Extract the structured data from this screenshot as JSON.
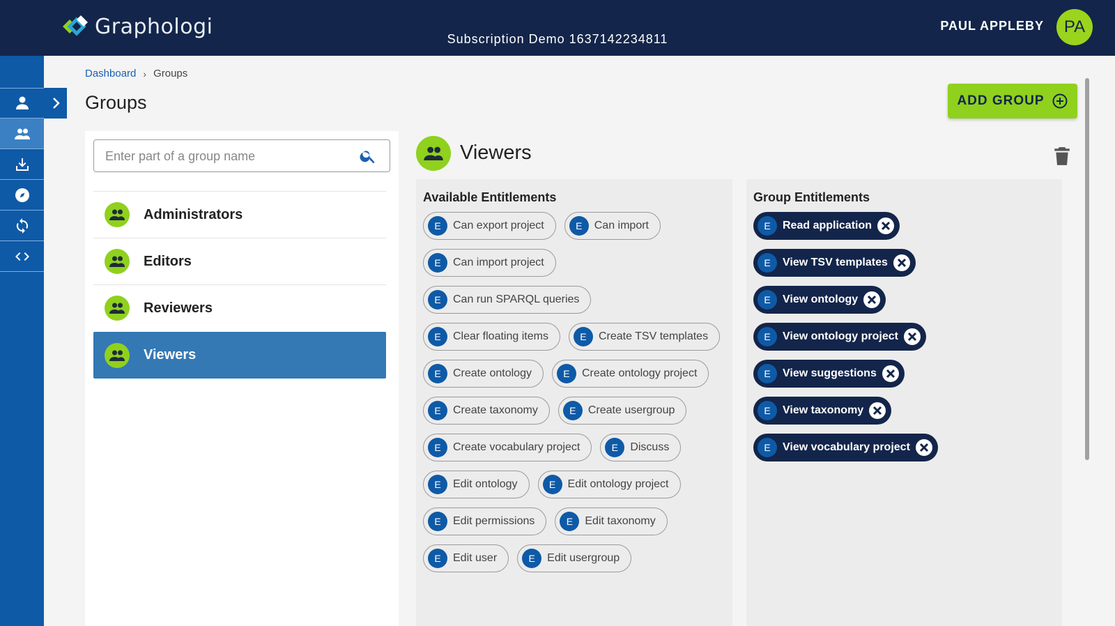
{
  "app": {
    "logo_text": "Graphologi",
    "subscription": "Subscription Demo 1637142234811",
    "user_name": "PAUL APPLEBY",
    "user_initials": "PA"
  },
  "rail": {
    "items": [
      {
        "icon": "person-icon"
      },
      {
        "icon": "people-icon",
        "active": true
      },
      {
        "icon": "download-icon"
      },
      {
        "icon": "compass-icon"
      },
      {
        "icon": "sync-icon"
      },
      {
        "icon": "code-icon"
      }
    ],
    "expand_icon": "chevron-right-icon"
  },
  "breadcrumb": {
    "items": [
      "Dashboard",
      "Groups"
    ],
    "separator": "›"
  },
  "page": {
    "title": "Groups",
    "add_button": "ADD GROUP"
  },
  "search": {
    "placeholder": "Enter part of a group name",
    "value": ""
  },
  "groups": [
    {
      "name": "Administrators",
      "selected": false
    },
    {
      "name": "Editors",
      "selected": false
    },
    {
      "name": "Reviewers",
      "selected": false
    },
    {
      "name": "Viewers",
      "selected": true
    }
  ],
  "detail": {
    "title": "Viewers",
    "available_title": "Available Entitlements",
    "group_title": "Group Entitlements",
    "chip_badge": "E",
    "available": [
      "Can export project",
      "Can import",
      "Can import project",
      "Can run SPARQL queries",
      "Clear floating items",
      "Create TSV templates",
      "Create ontology",
      "Create ontology project",
      "Create taxonomy",
      "Create usergroup",
      "Create vocabulary project",
      "Discuss",
      "Edit ontology",
      "Edit ontology project",
      "Edit permissions",
      "Edit taxonomy",
      "Edit user",
      "Edit usergroup"
    ],
    "assigned": [
      "Read application",
      "View TSV templates",
      "View ontology",
      "View ontology project",
      "View suggestions",
      "View taxonomy",
      "View vocabulary project"
    ]
  },
  "colors": {
    "topbar": "#13254a",
    "rail": "#0e5aa7",
    "accent": "#8fd11d",
    "selected": "#3478b4"
  }
}
